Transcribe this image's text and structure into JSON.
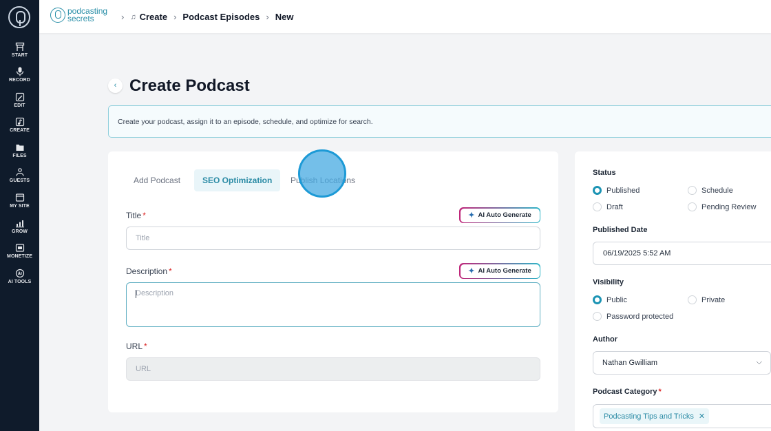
{
  "sidebar": {
    "items": [
      {
        "label": "START",
        "icon": "desk-icon"
      },
      {
        "label": "RECORD",
        "icon": "microphone-icon"
      },
      {
        "label": "EDIT",
        "icon": "edit-icon"
      },
      {
        "label": "CREATE",
        "icon": "music-note-icon"
      },
      {
        "label": "FILES",
        "icon": "files-icon"
      },
      {
        "label": "GUESTS",
        "icon": "guests-icon"
      },
      {
        "label": "MY SITE",
        "icon": "browser-icon"
      },
      {
        "label": "GROW",
        "icon": "chart-icon"
      },
      {
        "label": "MONETIZE",
        "icon": "monetize-icon"
      },
      {
        "label": "AI TOOLS",
        "icon": "ai-tools-icon"
      }
    ]
  },
  "brand": {
    "line1": "podcasting",
    "line2": "secrets"
  },
  "breadcrumb": {
    "items": [
      "Create",
      "Podcast Episodes",
      "New"
    ]
  },
  "page": {
    "title": "Create Podcast",
    "banner": "Create your podcast, assign it to an episode, schedule, and optimize for search."
  },
  "tabs": [
    {
      "label": "Add Podcast",
      "active": false
    },
    {
      "label": "SEO Optimization",
      "active": true
    },
    {
      "label": "Publish Locations",
      "active": false
    }
  ],
  "form": {
    "title_label": "Title",
    "title_placeholder": "Title",
    "description_label": "Description",
    "description_placeholder": "Description",
    "url_label": "URL",
    "url_placeholder": "URL",
    "required_mark": "*",
    "ai_button_label": "AI Auto Generate"
  },
  "sidepanel": {
    "status_label": "Status",
    "status_options": [
      "Published",
      "Schedule",
      "Draft",
      "Pending Review"
    ],
    "status_selected": "Published",
    "published_date_label": "Published Date",
    "published_date_value": "06/19/2025 5:52 AM",
    "visibility_label": "Visibility",
    "visibility_options": [
      "Public",
      "Private",
      "Password protected"
    ],
    "visibility_selected": "Public",
    "author_label": "Author",
    "author_value": "Nathan Gwilliam",
    "category_label": "Podcast Category",
    "category_chip": "Podcasting Tips and Tricks"
  },
  "colors": {
    "accent": "#1c94b4",
    "sidebar": "#0f1b2b",
    "required": "#dc2626"
  }
}
